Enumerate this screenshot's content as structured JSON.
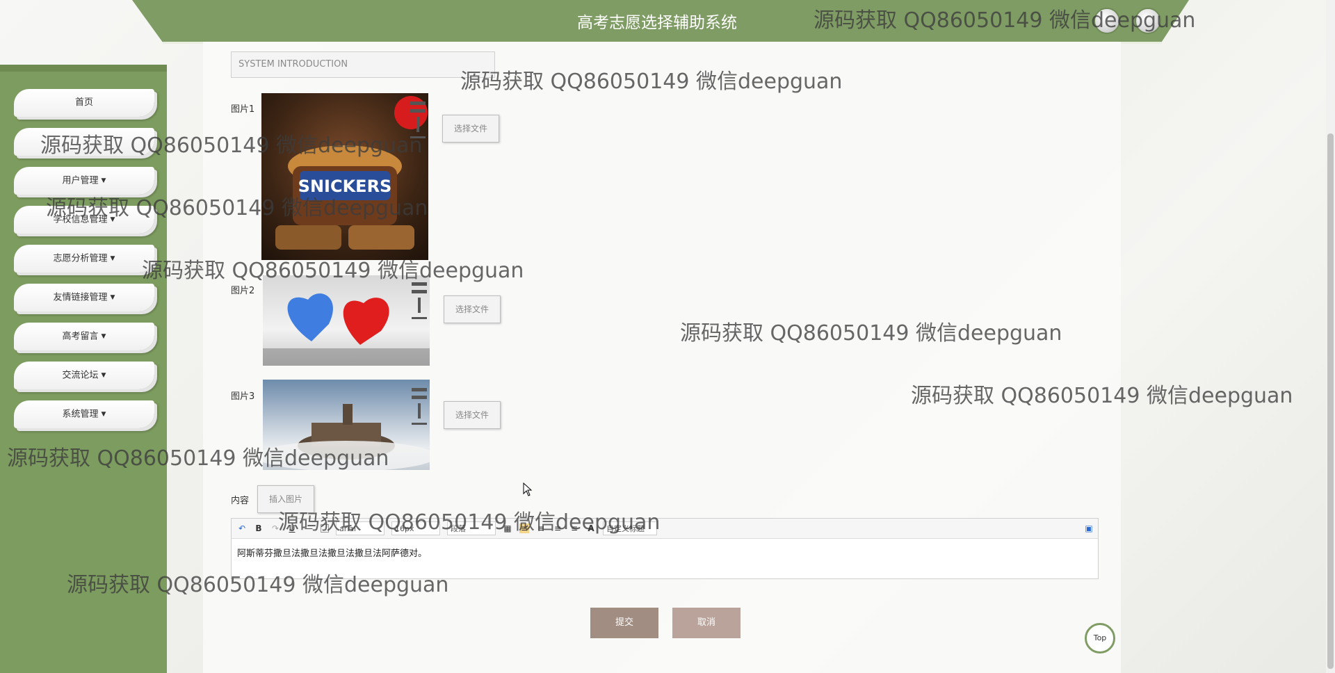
{
  "header": {
    "title": "高考志愿选择辅助系统"
  },
  "sidebar": {
    "items": [
      {
        "label": "首页",
        "has_caret": false
      },
      {
        "label": "",
        "has_caret": false
      },
      {
        "label": "用户管理",
        "has_caret": true
      },
      {
        "label": "学校信息管理",
        "has_caret": true
      },
      {
        "label": "志愿分析管理",
        "has_caret": true
      },
      {
        "label": "友情链接管理",
        "has_caret": true
      },
      {
        "label": "高考留言",
        "has_caret": true
      },
      {
        "label": "交流论坛",
        "has_caret": true
      },
      {
        "label": "系统管理",
        "has_caret": true
      }
    ]
  },
  "form": {
    "title_placeholder": "SYSTEM INTRODUCTION",
    "picture1_label": "图片1",
    "picture2_label": "图片2",
    "picture3_label": "图片3",
    "choose_file": "选择文件",
    "content_label": "内容",
    "insert_image": "插入图片",
    "editor": {
      "font_family": "arial",
      "font_size": "16px",
      "paragraph": "段落",
      "custom_heading": "自定义标题",
      "content": "阿斯蒂芬撒旦法撒旦法撒旦法撒旦法阿萨德对。"
    },
    "submit": "提交",
    "cancel": "取消"
  },
  "top_button": "Top",
  "watermark_text": "源码获取 QQ86050149 微信deepguan",
  "colors": {
    "accent_green": "#7f9c64",
    "submit_bg": "#a28d83",
    "cancel_bg": "#b9a39b"
  }
}
